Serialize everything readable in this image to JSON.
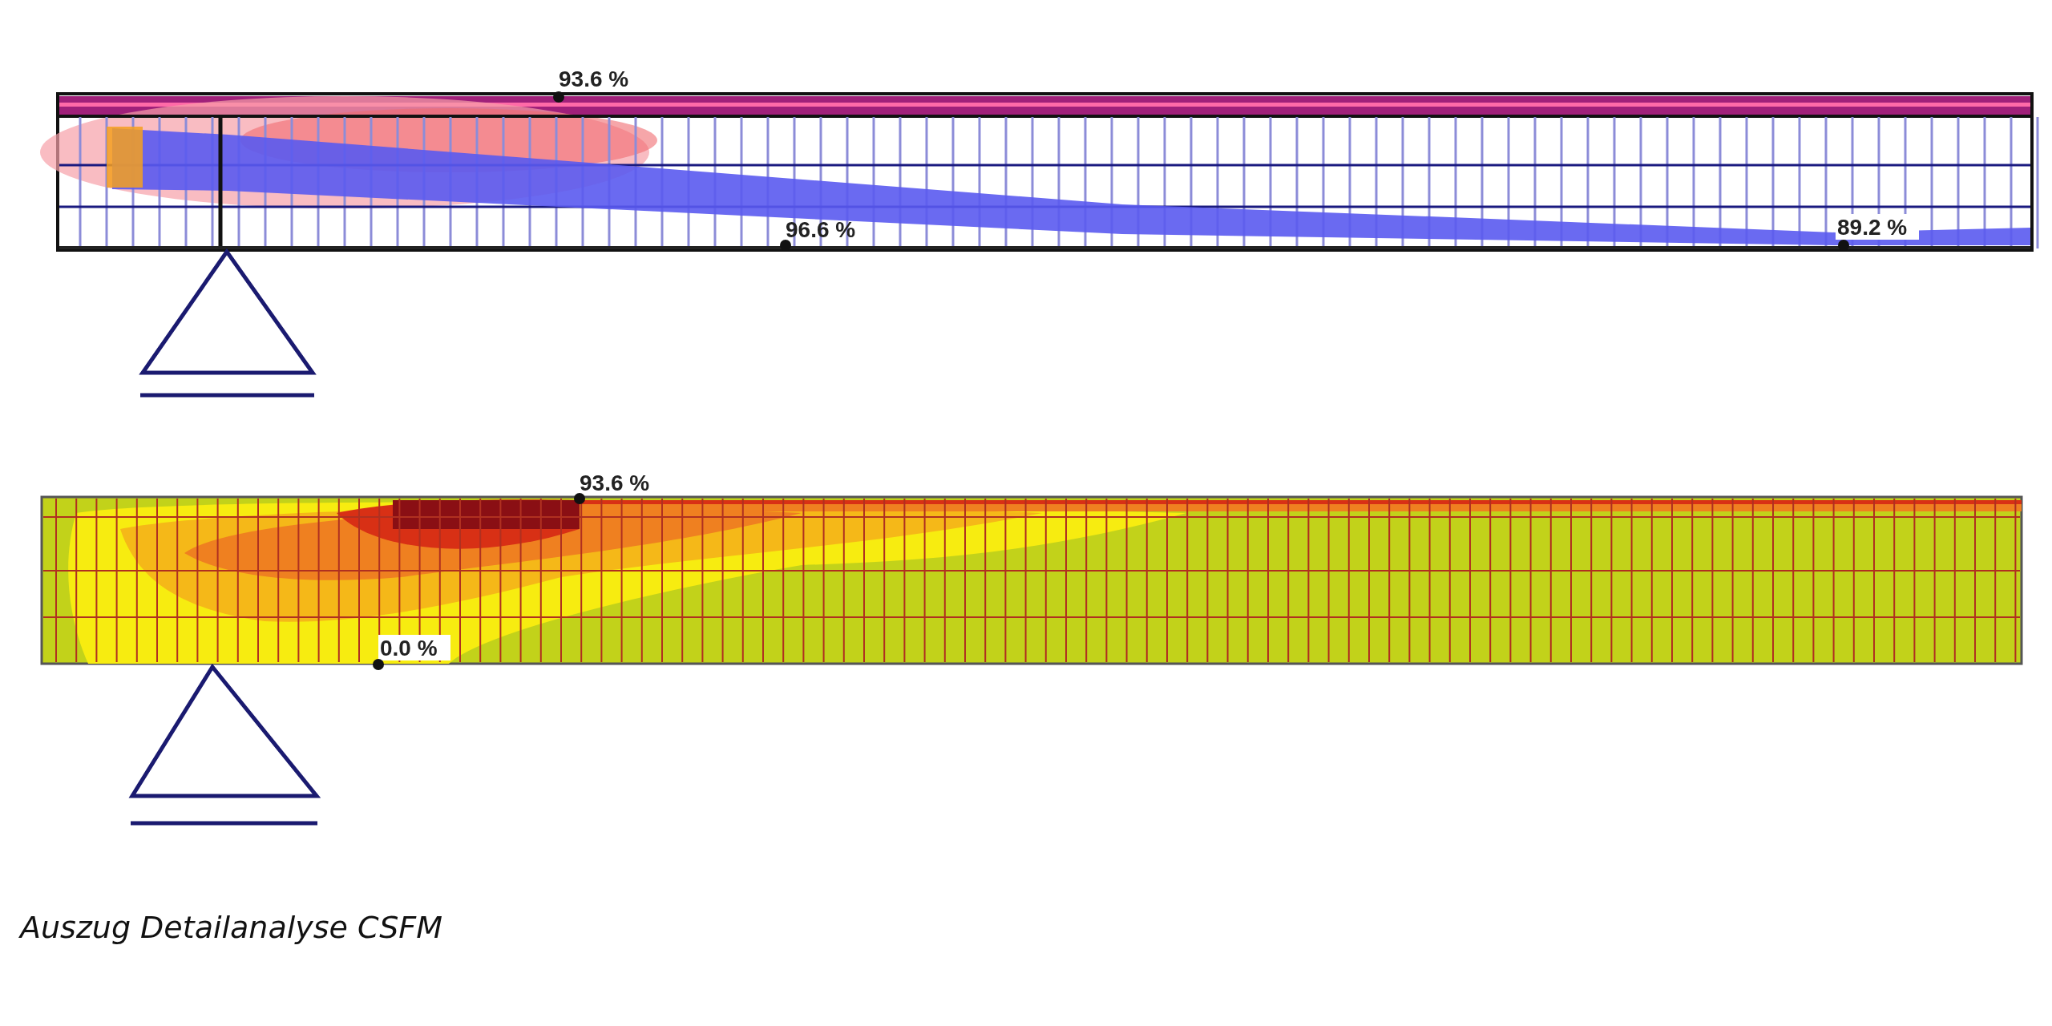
{
  "top_view": {
    "labels": [
      {
        "text": "93.6 %"
      },
      {
        "text": "96.6 %"
      },
      {
        "text": "89.2 %"
      }
    ]
  },
  "bottom_view": {
    "labels": [
      {
        "text": "93.6 %"
      },
      {
        "text": "0.0 %"
      }
    ]
  },
  "caption": "Auszug Detailanalyse CSFM"
}
